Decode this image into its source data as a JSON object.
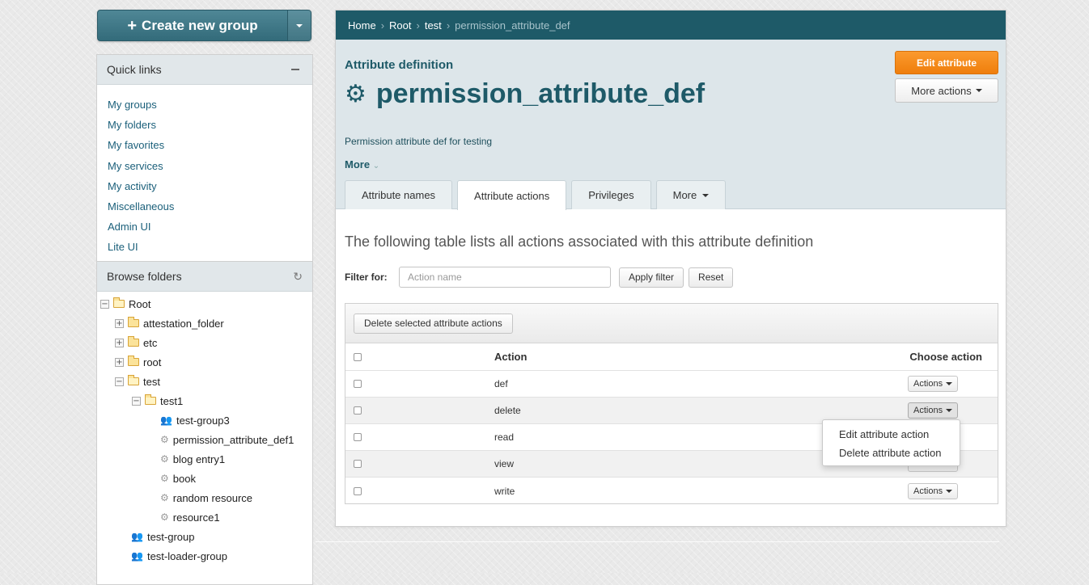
{
  "create_group": {
    "label": "Create new group",
    "plus": "+"
  },
  "quick_links": {
    "title": "Quick links",
    "items": [
      "My groups",
      "My folders",
      "My favorites",
      "My services",
      "My activity",
      "Miscellaneous",
      "Admin UI",
      "Lite UI"
    ]
  },
  "browse_folders": {
    "title": "Browse folders",
    "tree": [
      {
        "label": "Root",
        "toggle": "−",
        "icon": "folder-open-icon"
      },
      {
        "label": "attestation_folder",
        "toggle": "+",
        "icon": "folder-icon"
      },
      {
        "label": "etc",
        "toggle": "+",
        "icon": "folder-icon"
      },
      {
        "label": "root",
        "toggle": "+",
        "icon": "folder-icon"
      },
      {
        "label": "test",
        "toggle": "−",
        "icon": "folder-open-icon"
      },
      {
        "label": "test1",
        "toggle": "−",
        "icon": "folder-open-icon"
      },
      {
        "label": "test-group3",
        "icon": "group-icon"
      },
      {
        "label": "permission_attribute_def1",
        "icon": "gear-icon"
      },
      {
        "label": "blog entry1",
        "icon": "gears-icon"
      },
      {
        "label": "book",
        "icon": "gears-icon"
      },
      {
        "label": "random resource",
        "icon": "gears-icon"
      },
      {
        "label": "resource1",
        "icon": "gears-icon"
      },
      {
        "label": "test-group",
        "icon": "group-icon"
      },
      {
        "label": "test-loader-group",
        "icon": "group-icon"
      }
    ]
  },
  "breadcrumb": {
    "items": [
      "Home",
      "Root",
      "test"
    ],
    "current": "permission_attribute_def",
    "separator": "›"
  },
  "entity": {
    "kind": "Attribute definition",
    "name": "permission_attribute_def",
    "description": "Permission attribute def for testing",
    "more_label": "More"
  },
  "header_buttons": {
    "edit": "Edit attribute",
    "more_actions": "More actions"
  },
  "tabs": [
    "Attribute names",
    "Attribute actions",
    "Privileges",
    "More"
  ],
  "table": {
    "intro": "The following table lists all actions associated with this attribute definition",
    "filter_label": "Filter for:",
    "filter_placeholder": "Action name",
    "filter_value": "",
    "apply_label": "Apply filter",
    "reset_label": "Reset",
    "delete_selected_label": "Delete selected attribute actions",
    "headers": {
      "action": "Action",
      "choose": "Choose action"
    },
    "actions_button": "Actions",
    "rows": [
      "def",
      "delete",
      "read",
      "view",
      "write"
    ]
  },
  "dropdown": {
    "items": [
      "Edit attribute action",
      "Delete attribute action"
    ]
  },
  "colors": {
    "teal": "#1e5a68",
    "orange": "#f28a17",
    "link": "#1a5f7a"
  }
}
